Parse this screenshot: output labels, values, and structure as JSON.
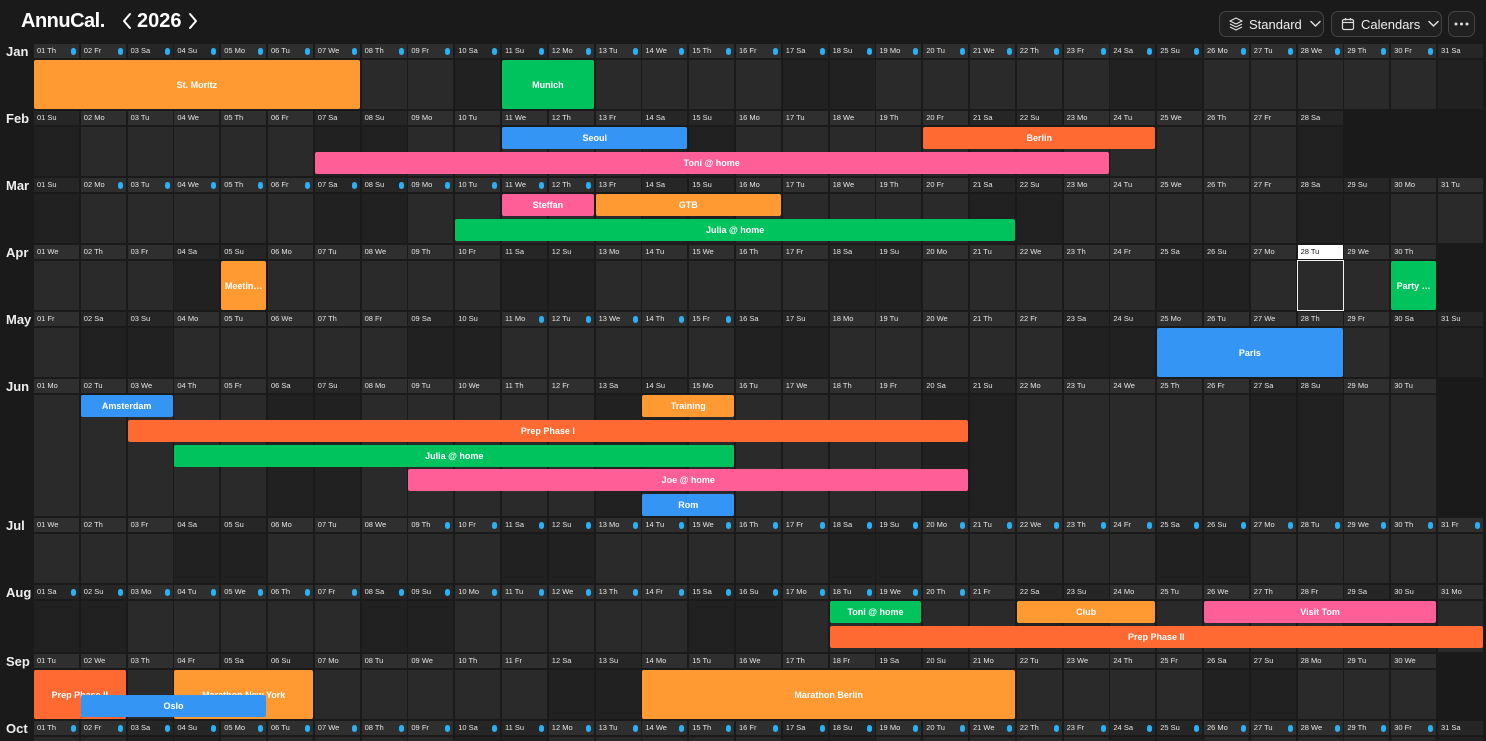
{
  "app": {
    "brand": "AnnuCal.",
    "year": "2026",
    "view_button": "Standard",
    "calendars_button": "Calendars"
  },
  "icons": {
    "prev": "chevron-left-icon",
    "next": "chevron-right-icon",
    "view": "layers-icon",
    "calendars": "calendar-icon",
    "dropdown": "chevron-down-icon",
    "more": "more-horizontal-icon"
  },
  "colors": {
    "orange": "#ff9a33",
    "red_orange": "#ff6a33",
    "green": "#00c35e",
    "blue": "#3595f5",
    "pink": "#ff5e97",
    "dot": "#2ab0f5"
  },
  "today": "Apr 28",
  "weekday_abbr": [
    "Mo",
    "Tu",
    "We",
    "Th",
    "Fr",
    "Sa",
    "Su"
  ],
  "months": [
    {
      "name": "Jan",
      "days": 31,
      "first_weekday": 3,
      "dot_days": [
        1,
        2,
        3,
        4,
        5,
        6,
        7,
        8,
        9,
        10,
        11,
        12,
        13,
        14,
        15,
        16,
        17,
        18,
        19,
        20,
        21,
        22,
        23,
        24,
        25,
        26,
        27,
        28,
        29,
        30
      ]
    },
    {
      "name": "Feb",
      "days": 28,
      "first_weekday": 6,
      "dot_days": []
    },
    {
      "name": "Mar",
      "days": 31,
      "first_weekday": 6,
      "dot_days": [
        2,
        3,
        4,
        5,
        6,
        7,
        8,
        9,
        10,
        11,
        12
      ]
    },
    {
      "name": "Apr",
      "days": 30,
      "first_weekday": 2,
      "dot_days": []
    },
    {
      "name": "May",
      "days": 31,
      "first_weekday": 4,
      "dot_days": [
        11,
        12,
        13,
        14,
        15
      ]
    },
    {
      "name": "Jun",
      "days": 30,
      "first_weekday": 0,
      "dot_days": []
    },
    {
      "name": "Jul",
      "days": 31,
      "first_weekday": 2,
      "dot_days": [
        9,
        10,
        11,
        12,
        13,
        14,
        15,
        16,
        17,
        18,
        19,
        20,
        21,
        22,
        23,
        24,
        25,
        26,
        27,
        28,
        29,
        30,
        31
      ]
    },
    {
      "name": "Aug",
      "days": 31,
      "first_weekday": 5,
      "dot_days": [
        1,
        2,
        3,
        4,
        5,
        6,
        7,
        8,
        9,
        10,
        11,
        12,
        13,
        14,
        15,
        16,
        17,
        18,
        19,
        20
      ]
    },
    {
      "name": "Sep",
      "days": 30,
      "first_weekday": 1,
      "dot_days": []
    },
    {
      "name": "Oct",
      "days": 31,
      "first_weekday": 3,
      "dot_days": [
        1,
        2,
        3,
        4,
        5,
        6,
        7,
        8,
        9,
        10,
        11,
        12,
        13,
        14,
        15,
        16,
        17,
        18,
        19,
        20,
        21,
        22,
        23,
        24,
        25,
        26,
        27,
        28,
        29,
        30
      ]
    }
  ],
  "events": [
    {
      "label": "St. Moritz",
      "month": 0,
      "start": 1,
      "end": 7,
      "lane": 0,
      "color": "#ff9a33"
    },
    {
      "label": "Munich",
      "month": 0,
      "start": 11,
      "end": 12,
      "lane": 0,
      "color": "#00c35e"
    },
    {
      "label": "Seoul",
      "month": 1,
      "start": 11,
      "end": 14,
      "lane": 0,
      "color": "#3595f5"
    },
    {
      "label": "Berlin",
      "month": 1,
      "start": 20,
      "end": 24,
      "lane": 0,
      "color": "#ff6a33"
    },
    {
      "label": "Toni @ home",
      "month": 1,
      "start": 7,
      "end": 23,
      "lane": 1,
      "color": "#ff5e97"
    },
    {
      "label": "Steffan",
      "month": 2,
      "start": 11,
      "end": 12,
      "lane": 0,
      "color": "#ff5e97"
    },
    {
      "label": "GTB",
      "month": 2,
      "start": 13,
      "end": 16,
      "lane": 0,
      "color": "#ff9a33"
    },
    {
      "label": "Julia @ home",
      "month": 2,
      "start": 10,
      "end": 21,
      "lane": 1,
      "color": "#00c35e"
    },
    {
      "label": "Meetin…",
      "month": 3,
      "start": 5,
      "end": 5,
      "lane": 0,
      "color": "#ff9a33"
    },
    {
      "label": "Party …",
      "month": 3,
      "start": 30,
      "end": 30,
      "lane": 0,
      "color": "#00c35e"
    },
    {
      "label": "Paris",
      "month": 4,
      "start": 25,
      "end": 28,
      "lane": 0,
      "color": "#3595f5"
    },
    {
      "label": "Amsterdam",
      "month": 5,
      "start": 2,
      "end": 3,
      "lane": 0,
      "color": "#3595f5"
    },
    {
      "label": "Training",
      "month": 5,
      "start": 14,
      "end": 15,
      "lane": 0,
      "color": "#ff9a33"
    },
    {
      "label": "Prep Phase I",
      "month": 5,
      "start": 3,
      "end": 20,
      "lane": 1,
      "color": "#ff6a33"
    },
    {
      "label": "Julia @ home",
      "month": 5,
      "start": 4,
      "end": 15,
      "lane": 2,
      "color": "#00c35e"
    },
    {
      "label": "Joe @ home",
      "month": 5,
      "start": 9,
      "end": 20,
      "lane": 3,
      "color": "#ff5e97"
    },
    {
      "label": "Rom",
      "month": 5,
      "start": 14,
      "end": 15,
      "lane": 4,
      "color": "#3595f5"
    },
    {
      "label": "Toni @ home",
      "month": 7,
      "start": 18,
      "end": 19,
      "lane": 0,
      "color": "#00c35e"
    },
    {
      "label": "Club",
      "month": 7,
      "start": 22,
      "end": 24,
      "lane": 0,
      "color": "#ff9a33"
    },
    {
      "label": "Visit Tom",
      "month": 7,
      "start": 26,
      "end": 30,
      "lane": 0,
      "color": "#ff5e97"
    },
    {
      "label": "Prep Phase II",
      "month": 7,
      "start": 18,
      "end": 31,
      "lane": 1,
      "color": "#ff6a33"
    },
    {
      "label": "Prep Phase II",
      "month": 8,
      "start": 1,
      "end": 2,
      "lane": 0,
      "color": "#ff6a33"
    },
    {
      "label": "Marathon New York",
      "month": 8,
      "start": 4,
      "end": 6,
      "lane": 0,
      "color": "#ff9a33"
    },
    {
      "label": "Marathon Berlin",
      "month": 8,
      "start": 14,
      "end": 21,
      "lane": 0,
      "color": "#ff9a33",
      "tall": true
    },
    {
      "label": "Oslo",
      "month": 8,
      "start": 2,
      "end": 5,
      "lane": 1,
      "color": "#3595f5"
    }
  ]
}
